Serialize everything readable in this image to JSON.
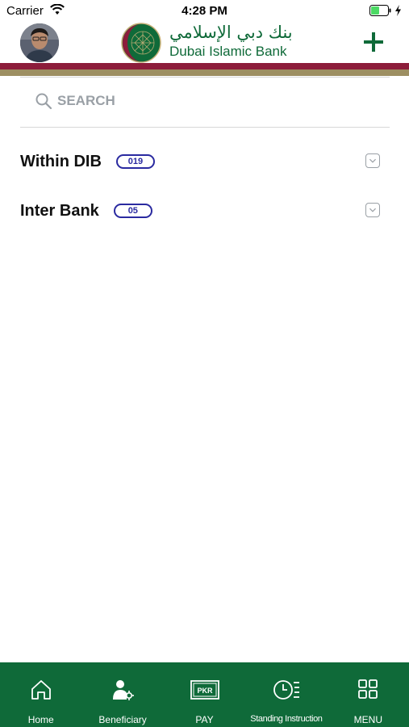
{
  "status_bar": {
    "carrier": "Carrier",
    "time": "4:28 PM"
  },
  "header": {
    "bank_name_arabic": "بنك دبي الإسلامي",
    "bank_name_english": "Dubai Islamic Bank",
    "add_icon": "plus-icon",
    "brand_color": "#0f6a39",
    "accent_bar_colors": [
      "#8c1d3a",
      "#9d8f62"
    ]
  },
  "search": {
    "placeholder": "SEARCH",
    "value": ""
  },
  "groups": [
    {
      "label": "Within DIB",
      "count": "019"
    },
    {
      "label": "Inter Bank",
      "count": "05"
    }
  ],
  "bottom_nav": {
    "items": [
      {
        "label": "Home",
        "icon": "home-icon"
      },
      {
        "label": "Beneficiary",
        "icon": "beneficiary-settings-icon"
      },
      {
        "label": "PAY",
        "icon": "pkr-banknote-icon",
        "icon_text": "PKR"
      },
      {
        "label": "Standing Instruction",
        "icon": "clock-list-icon"
      },
      {
        "label": "MENU",
        "icon": "grid-menu-icon"
      }
    ]
  }
}
